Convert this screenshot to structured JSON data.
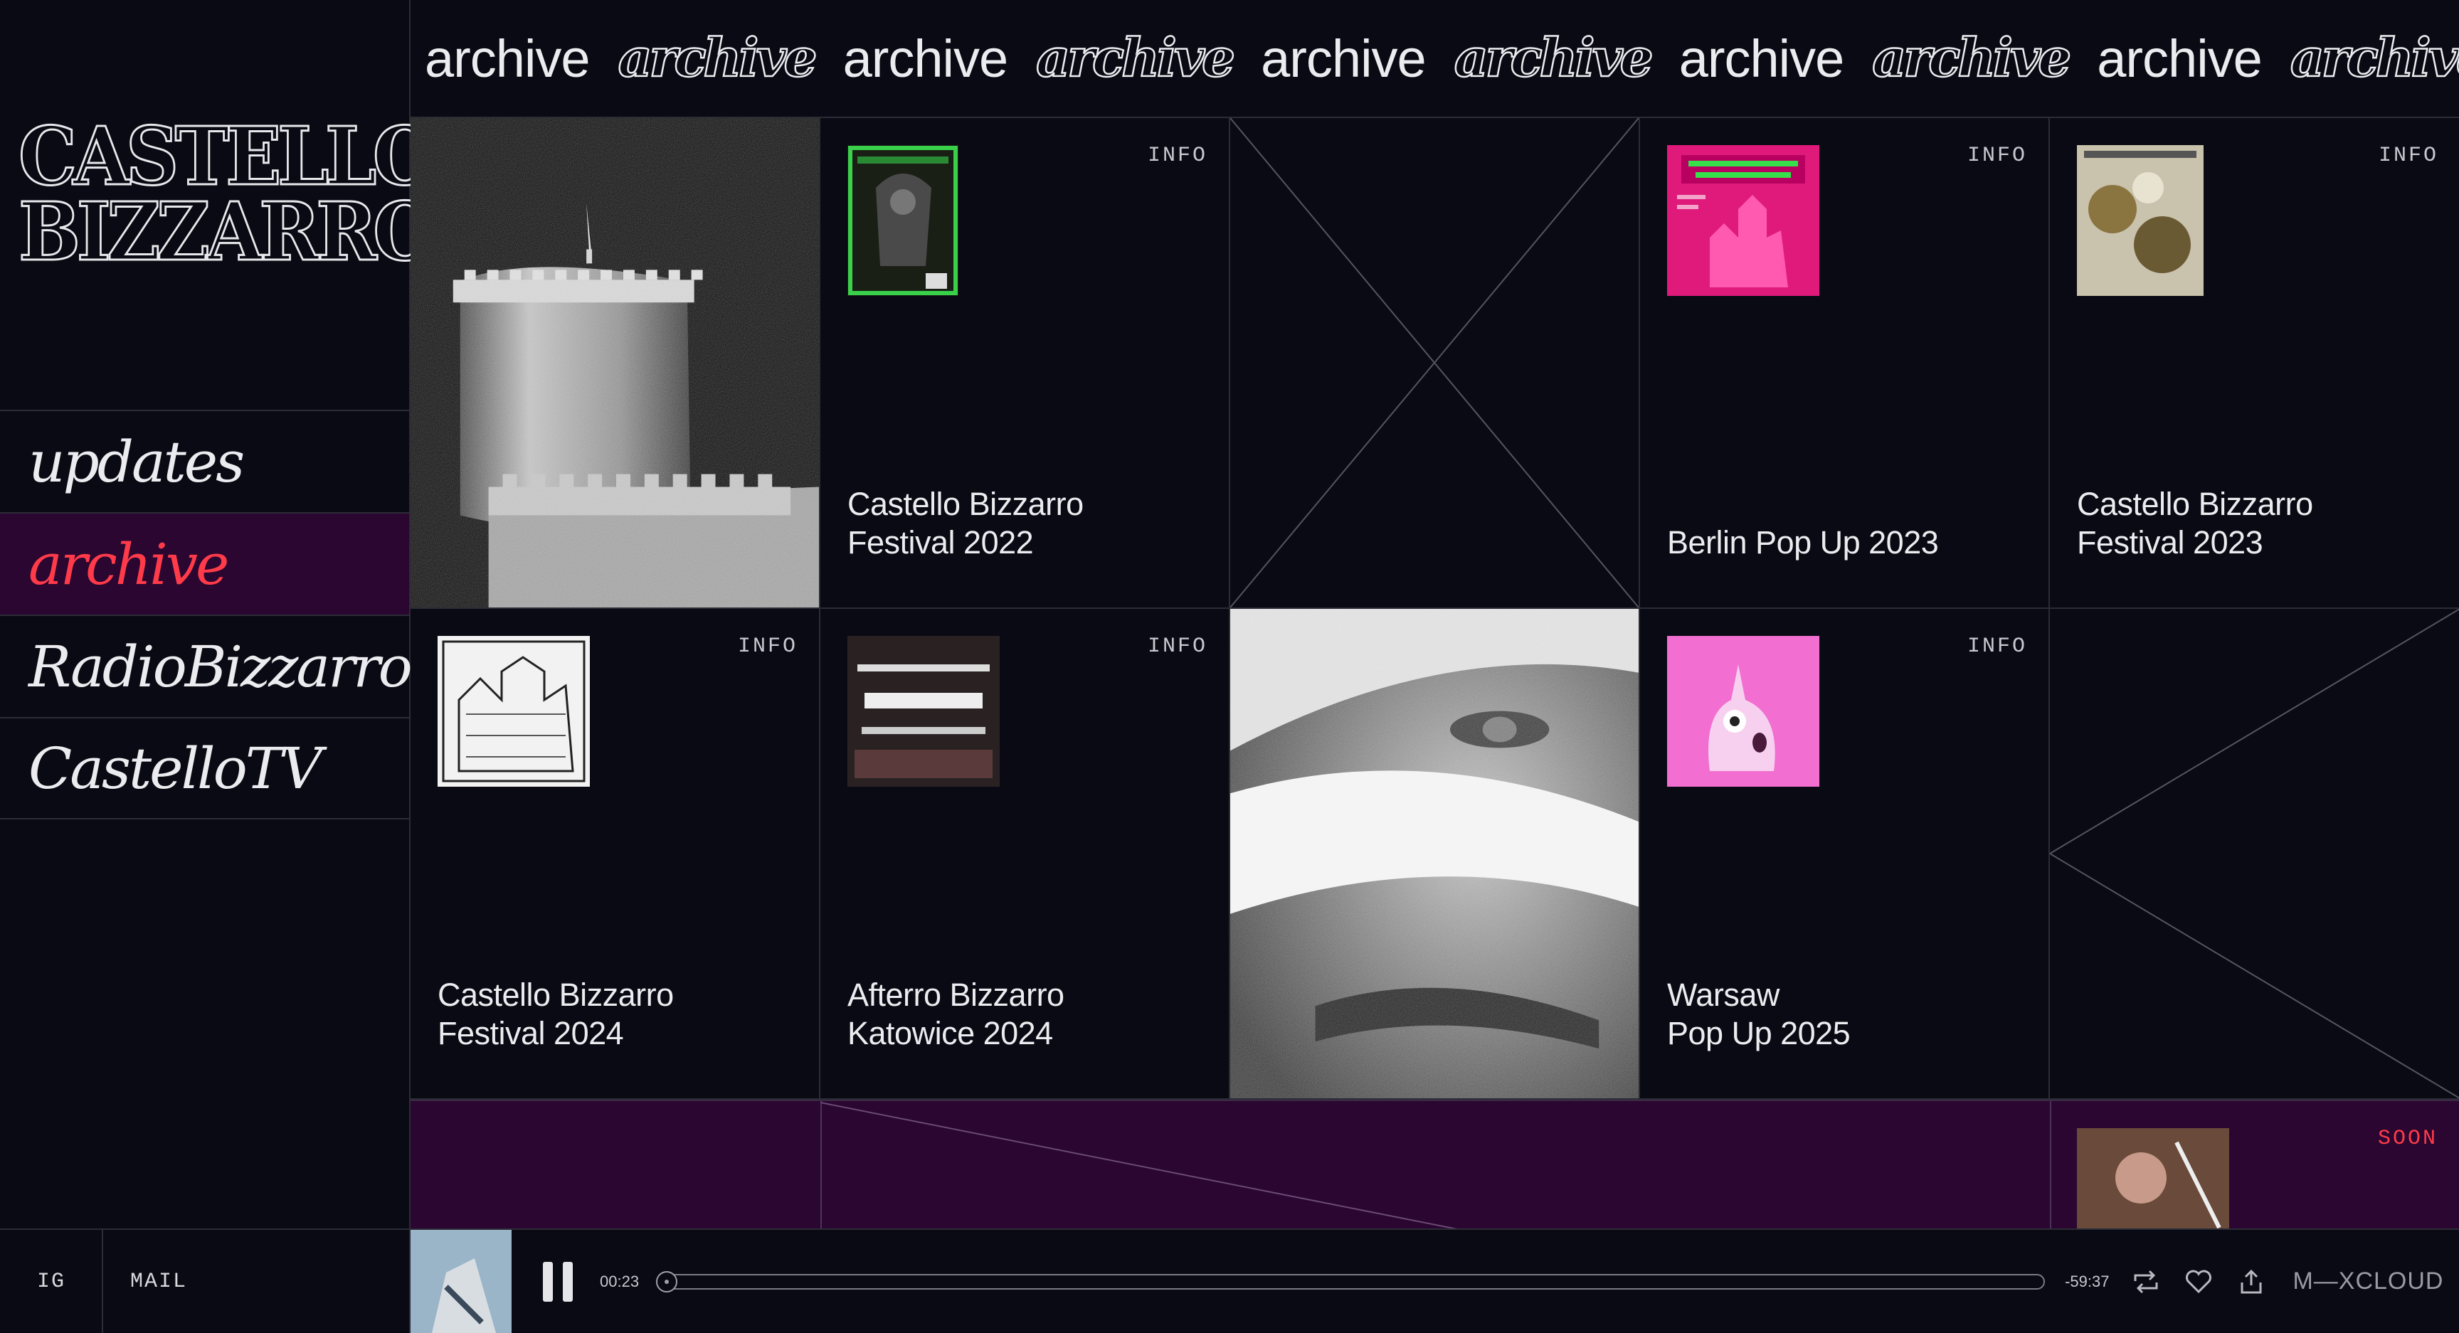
{
  "brand": {
    "logo_line1": "CASTELLO",
    "logo_line2": "BIZZARRO"
  },
  "nav": {
    "items": [
      {
        "label": "updates"
      },
      {
        "label": "archive"
      },
      {
        "label": "RadioBizzarro"
      },
      {
        "label": "CastelloTV"
      }
    ]
  },
  "footer": {
    "ig": "IG",
    "mail": "MAIL"
  },
  "marquee": {
    "word": "archive",
    "visible_tail": "arc"
  },
  "grid": {
    "info_label": "INFO",
    "soon_label": "SOON",
    "items": [
      {
        "title_line1": "Castello Bizzarro",
        "title_line2": "Festival 2022"
      },
      {
        "title_line1": "",
        "title_line2": "Berlin Pop Up 2023"
      },
      {
        "title_line1": "Castello Bizzarro",
        "title_line2": "Festival 2023"
      },
      {
        "title_line1": "Castello Bizzarro",
        "title_line2": "Festival 2024"
      },
      {
        "title_line1": "Afterro Bizzarro",
        "title_line2": "Katowice 2024"
      },
      {
        "title_line1": "Warsaw",
        "title_line2": "Pop Up 2025"
      }
    ]
  },
  "player": {
    "elapsed": "00:23",
    "remaining": "-59:37",
    "progress_fraction": 0.0,
    "brand": "M—XCLOUD"
  },
  "colors": {
    "background": "#0a0a14",
    "active_nav_bg": "#2a0630",
    "accent_red": "#ff3b4a",
    "grid_line": "#2c2c36"
  }
}
